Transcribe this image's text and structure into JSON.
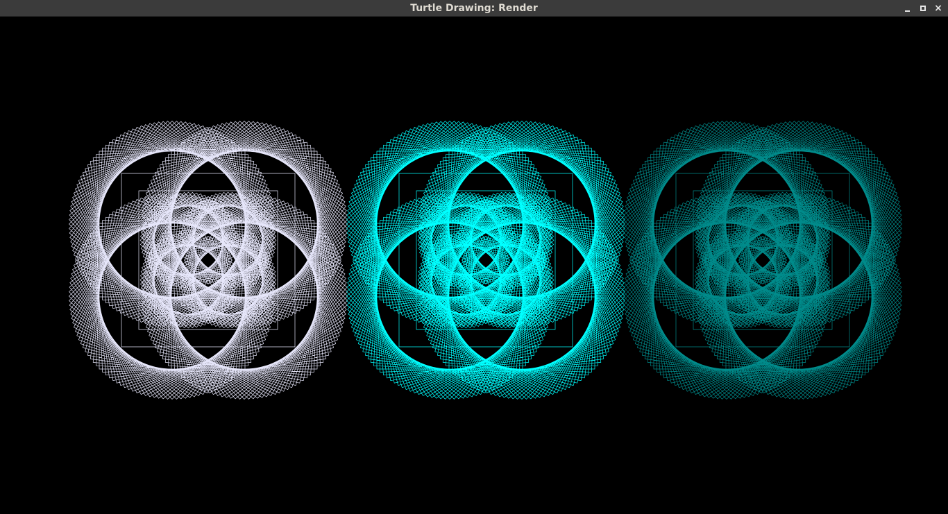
{
  "window": {
    "title": "Turtle Drawing: Render",
    "controls": [
      {
        "name": "minimize",
        "icon": "minimize-icon"
      },
      {
        "name": "maximize",
        "icon": "maximize-icon"
      },
      {
        "name": "close",
        "icon": "close-icon"
      }
    ]
  },
  "canvas": {
    "background": "#000000",
    "figures": [
      {
        "name": "lavender-figure",
        "color": "#e6e6fa"
      },
      {
        "name": "cyan-figure",
        "color": "#00ffff"
      },
      {
        "name": "teal-figure",
        "color": "#008b8b"
      }
    ]
  }
}
